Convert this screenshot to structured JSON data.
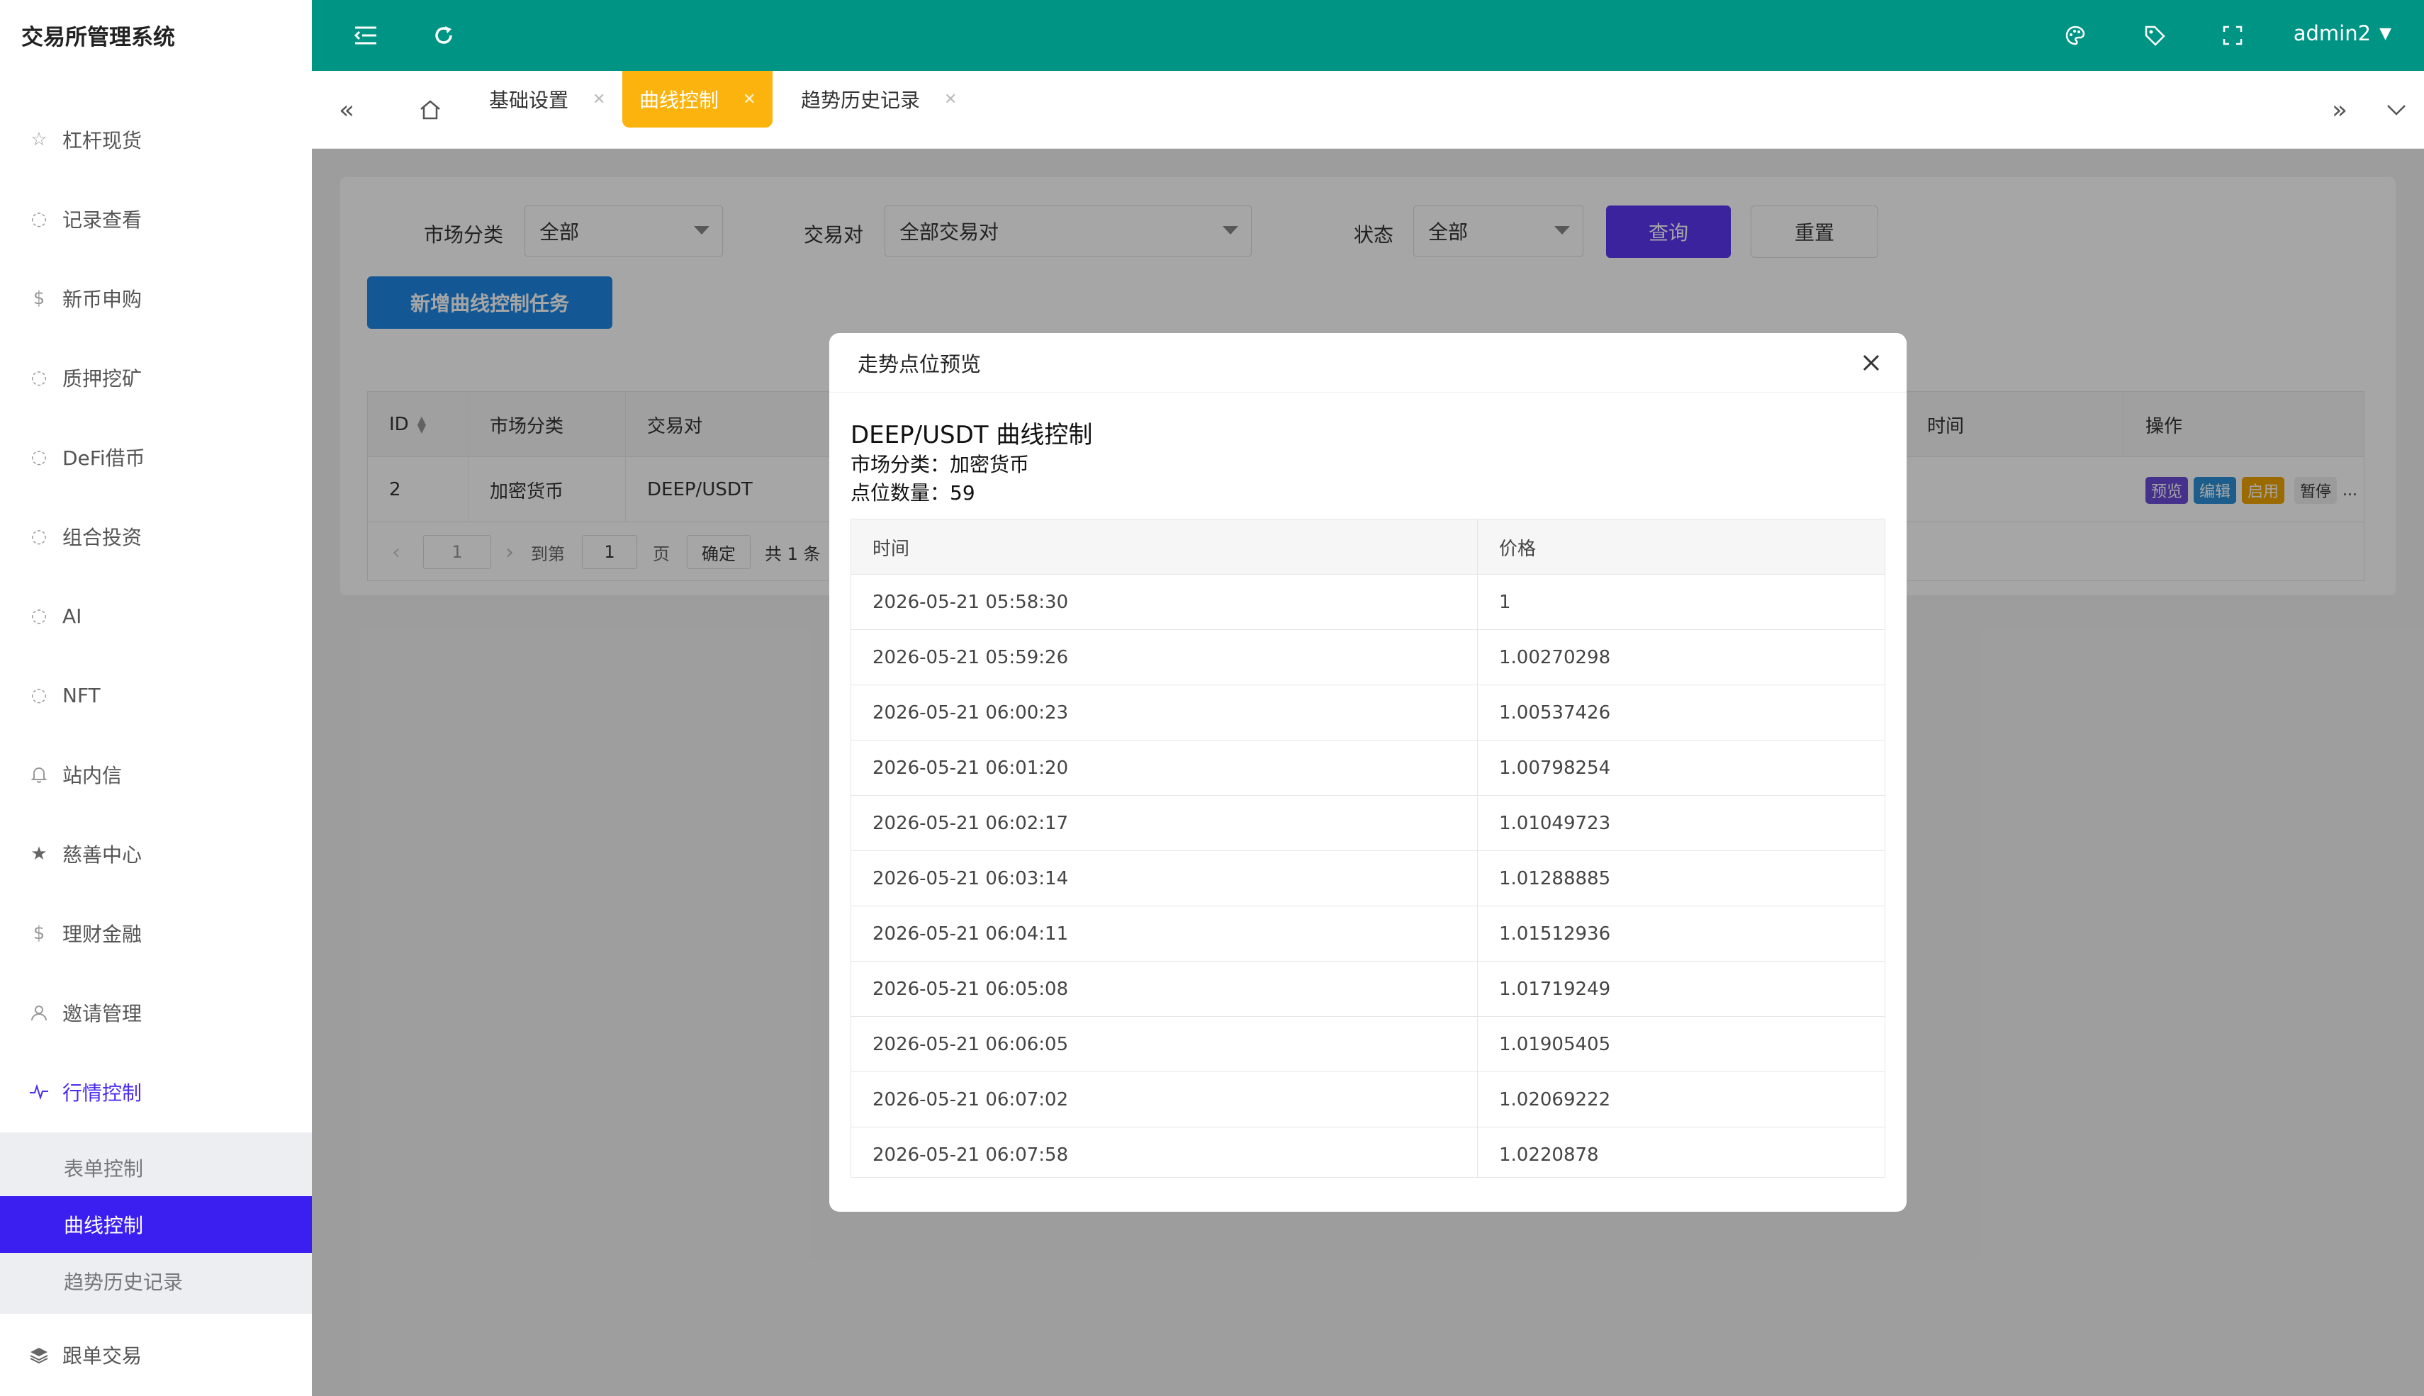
{
  "app": {
    "title": "交易所管理系统"
  },
  "sidebar": {
    "items": [
      {
        "label": "杠杆现货",
        "icon": "star-outline-icon"
      },
      {
        "label": "记录查看",
        "icon": "circle-dot-icon"
      },
      {
        "label": "新币申购",
        "icon": "dollar-circle-icon"
      },
      {
        "label": "质押挖矿",
        "icon": "circle-dot-icon"
      },
      {
        "label": "DeFi借币",
        "icon": "circle-dot-icon"
      },
      {
        "label": "组合投资",
        "icon": "circle-dot-icon"
      },
      {
        "label": "AI",
        "icon": "circle-dot-icon"
      },
      {
        "label": "NFT",
        "icon": "circle-dot-icon"
      },
      {
        "label": "站内信",
        "icon": "bell-icon"
      },
      {
        "label": "慈善中心",
        "icon": "star-filled-icon"
      },
      {
        "label": "理财金融",
        "icon": "dollar-circle-icon"
      },
      {
        "label": "邀请管理",
        "icon": "user-icon"
      },
      {
        "label": "行情控制",
        "icon": "pulse-icon"
      },
      {
        "label": "跟单交易",
        "icon": "layers-icon"
      }
    ],
    "submenu": [
      "表单控制",
      "曲线控制",
      "趋势历史记录"
    ],
    "active_submenu": "曲线控制"
  },
  "header": {
    "user": "admin2",
    "icons": [
      "menu-fold-icon",
      "refresh-icon",
      "theme-icon",
      "tag-icon",
      "fullscreen-icon"
    ]
  },
  "tabs": [
    {
      "label": "基础设置",
      "active": false
    },
    {
      "label": "曲线控制",
      "active": true
    },
    {
      "label": "趋势历史记录",
      "active": false
    }
  ],
  "filters": {
    "market_label": "市场分类",
    "market_value": "全部",
    "pair_label": "交易对",
    "pair_value": "全部交易对",
    "status_label": "状态",
    "status_value": "全部",
    "query_button": "查询",
    "reset_button": "重置",
    "add_button": "新增曲线控制任务"
  },
  "table": {
    "headers": [
      "ID",
      "市场分类",
      "交易对",
      "时间",
      "操作"
    ],
    "rows": [
      {
        "id": "2",
        "market": "加密货币",
        "pair": "DEEP/USDT"
      }
    ],
    "actions": [
      {
        "label": "预览",
        "color": "#6a4bd8"
      },
      {
        "label": "编辑",
        "color": "#2b8fd8"
      },
      {
        "label": "启用",
        "color": "#f0a500"
      },
      {
        "label": "暂停",
        "color": "#eeeeee"
      }
    ],
    "more": "..."
  },
  "pager": {
    "current": "1",
    "goto_label": "到第",
    "goto_value": "1",
    "page_label": "页",
    "confirm": "确定",
    "total": "共 1 条"
  },
  "modal": {
    "header": "走势点位预览",
    "title": "DEEP/USDT 曲线控制",
    "market_line": "市场分类：加密货币",
    "count_line": "点位数量：59",
    "columns": [
      "时间",
      "价格"
    ],
    "rows": [
      {
        "time": "2026-05-21 05:58:30",
        "price": "1"
      },
      {
        "time": "2026-05-21 05:59:26",
        "price": "1.00270298"
      },
      {
        "time": "2026-05-21 06:00:23",
        "price": "1.00537426"
      },
      {
        "time": "2026-05-21 06:01:20",
        "price": "1.00798254"
      },
      {
        "time": "2026-05-21 06:02:17",
        "price": "1.01049723"
      },
      {
        "time": "2026-05-21 06:03:14",
        "price": "1.01288885"
      },
      {
        "time": "2026-05-21 06:04:11",
        "price": "1.01512936"
      },
      {
        "time": "2026-05-21 06:05:08",
        "price": "1.01719249"
      },
      {
        "time": "2026-05-21 06:06:05",
        "price": "1.01905405"
      },
      {
        "time": "2026-05-21 06:07:02",
        "price": "1.02069222"
      },
      {
        "time": "2026-05-21 06:07:58",
        "price": "1.0220878"
      }
    ]
  }
}
